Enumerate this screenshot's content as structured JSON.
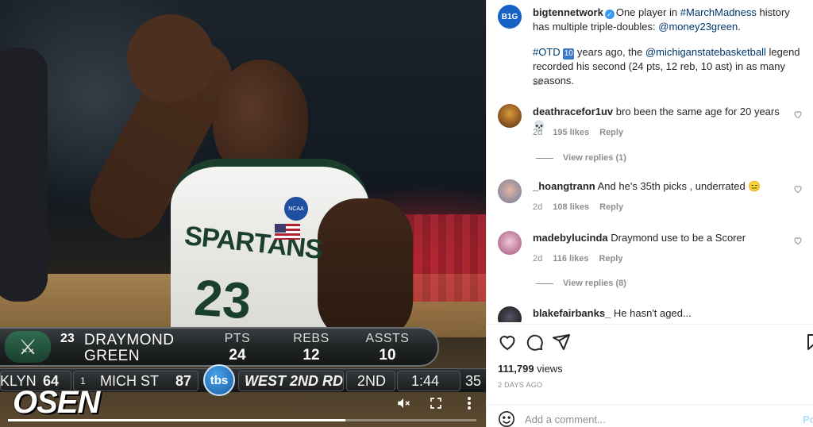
{
  "video": {
    "watermark": "OSEN",
    "progress_fraction": 0.72,
    "scoreboard": {
      "jersey_number": "23",
      "first_name": "DRAYMOND",
      "last_name": "GREEN",
      "stats": [
        {
          "label": "PTS",
          "value": "24"
        },
        {
          "label": "REBS",
          "value": "12"
        },
        {
          "label": "ASSTS",
          "value": "10"
        }
      ],
      "team_left_abbr": "KLYN",
      "team_left_score": "64",
      "seed": "1",
      "team_right_abbr": "MICH ST",
      "team_right_score": "87",
      "network": "tbs",
      "round": "WEST 2ND RD",
      "period": "2ND",
      "clock": "1:44",
      "shot_clock": "35"
    },
    "controls": {
      "mute_icon": "mute-icon",
      "fullscreen_icon": "fullscreen-icon",
      "more_icon": "more-vertical-icon"
    }
  },
  "post": {
    "author": "bigtennetwork",
    "author_avatar_text": "B1G",
    "verified": true,
    "caption_part1": "One player in ",
    "hashtag1": "#MarchMadness",
    "caption_part2": " history has multiple triple-doubles: ",
    "mention1": "@money23green",
    "caption_part3": ".",
    "hashtag2": "#OTD",
    "number_badge": "10",
    "caption_part4": " years ago, the ",
    "mention2": "@michiganstatebasketball",
    "caption_part5": " legend recorded his second (24 pts, 12 reb, 10 ast) in as many seasons.",
    "time": "2d"
  },
  "comments": [
    {
      "username": "deathracefor1uv",
      "text": "bro been the same age for 20 years💀",
      "time": "2d",
      "likes": "195 likes",
      "reply_label": "Reply",
      "view_replies": "View replies (1)"
    },
    {
      "username": "_hoangtrann",
      "text": "And he's 35th picks , underrated 😑",
      "time": "2d",
      "likes": "108 likes",
      "reply_label": "Reply",
      "view_replies": ""
    },
    {
      "username": "madebylucinda",
      "text": "Draymond use to be a Scorer",
      "time": "2d",
      "likes": "116 likes",
      "reply_label": "Reply",
      "view_replies": "View replies (8)"
    },
    {
      "username": "blakefairbanks_",
      "text": "He hasn't aged...",
      "time": "",
      "likes": "",
      "reply_label": "",
      "view_replies": ""
    }
  ],
  "actions": {
    "like_icon": "heart-icon",
    "comment_icon": "comment-icon",
    "share_icon": "share-icon",
    "save_icon": "bookmark-icon",
    "views_count": "111,799",
    "views_label": " views",
    "date": "2 DAYS AGO"
  },
  "add_comment": {
    "placeholder": "Add a comment...",
    "post_label": "Post",
    "emoji_icon": "emoji-icon"
  }
}
